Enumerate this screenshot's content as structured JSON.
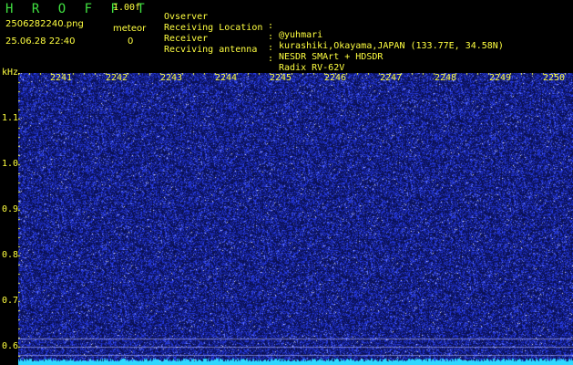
{
  "header": {
    "app_title": "H R O F F T",
    "version": "1.00f",
    "filename": "2506282240.png",
    "datetime": "25.06.28 22:40",
    "meteor_label": "meteor",
    "meteor_count": "0"
  },
  "info": [
    {
      "label": "Ovserver",
      "sep": ":",
      "value": "@yuhmari"
    },
    {
      "label": "Receiving Location",
      "sep": ":",
      "value": "kurashiki,Okayama,JAPAN (133.77E, 34.58N)"
    },
    {
      "label": "Receiver",
      "sep": ":",
      "value": "NESDR SMArt + HDSDR"
    },
    {
      "label": "Recviving antenna",
      "sep": ":",
      "value": "Radix RV-62V"
    }
  ],
  "spectrogram": {
    "unit": "kHz",
    "time_labels": [
      "2241",
      "2242",
      "2243",
      "2244",
      "2245",
      "2246",
      "2247",
      "2248",
      "2249",
      "2250"
    ],
    "freq_labels": [
      "1.1",
      "1.0",
      "0.9",
      "0.8",
      "0.7",
      "0.6"
    ],
    "colors": {
      "background": "#10186a",
      "noise": "#3a4cff",
      "bright_noise": "#ffffff",
      "baseline": "#30d8ff",
      "label": "#ffff40",
      "header_green": "#40e040"
    }
  }
}
